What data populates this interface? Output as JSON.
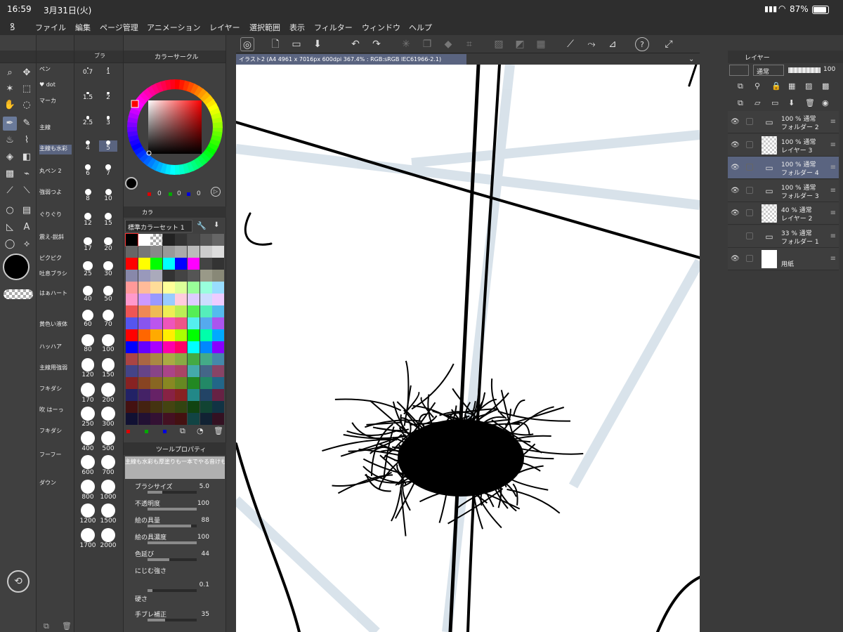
{
  "status": {
    "time": "16:59",
    "date": "3月31日(火)",
    "battery": "87%"
  },
  "menu": [
    "ファイル",
    "編集",
    "ページ管理",
    "アニメーション",
    "レイヤー",
    "選択範囲",
    "表示",
    "フィルター",
    "ウィンドウ",
    "ヘルプ"
  ],
  "doc_tab": "イラスト2 (A4 4961 x 7016px 600dpi 367.4% : RGB:sRGB IEC61966-2.1)",
  "panels": {
    "color_circle": "カラーサークル",
    "color_set_tab": "カラ",
    "color_set_name": "標準カラーセット 1",
    "tool_property": "ツールプロパティ",
    "layer": "レイヤー",
    "brush_tab": "ブラ"
  },
  "color_values": [
    "0",
    "0",
    "0"
  ],
  "subtools": [
    {
      "label": "ペン"
    },
    {
      "label": "♥ dot"
    },
    {
      "label": "マーカ"
    },
    {
      "label": "主線"
    },
    {
      "label": "主線も水彩"
    },
    {
      "label": "丸ペン 2"
    },
    {
      "label": "強弱つよ"
    },
    {
      "label": "ぐりぐり"
    },
    {
      "label": "震え-鋭斜"
    },
    {
      "label": "ピクピク"
    },
    {
      "label": "吐息ブラシ"
    },
    {
      "label": "はぁハート"
    },
    {
      "label": "黄色い液体"
    },
    {
      "label": "ハッハア"
    },
    {
      "label": "主線用強弱"
    },
    {
      "label": "フキダシ"
    },
    {
      "label": "吹 はーっ"
    },
    {
      "label": "フキダシ"
    },
    {
      "label": "フーフー"
    },
    {
      "label": "ダウン"
    }
  ],
  "brush_sizes": [
    "0.7",
    "1",
    "1.5",
    "2",
    "2.5",
    "3",
    "4",
    "5",
    "6",
    "7",
    "8",
    "10",
    "12",
    "15",
    "17",
    "20",
    "25",
    "30",
    "40",
    "50",
    "60",
    "70",
    "80",
    "100",
    "120",
    "150",
    "170",
    "200",
    "250",
    "300",
    "400",
    "500",
    "600",
    "700",
    "800",
    "1000",
    "1200",
    "1500",
    "1700",
    "2000"
  ],
  "brush_selected": "5",
  "tool_props": {
    "subtool_name": "主線も水彩も厚塗りも一本でやる音けものブラシ",
    "rows": [
      {
        "label": "ブラシサイズ",
        "value": "5.0",
        "level": 0.3
      },
      {
        "label": "不透明度",
        "value": "100",
        "level": 1.0
      },
      {
        "label": "絵の具量",
        "value": "88",
        "level": 0.88
      },
      {
        "label": "絵の具濃度",
        "value": "100",
        "level": 1.0
      },
      {
        "label": "色延び",
        "value": "44",
        "level": 0.44
      },
      {
        "label": "にじむ強さ",
        "value": "",
        "level": 0
      },
      {
        "label": "",
        "value": "0.1",
        "level": 0.1
      },
      {
        "label": "硬さ",
        "value": "",
        "level": 0
      },
      {
        "label": "手ブレ補正",
        "value": "35",
        "level": 0.35
      }
    ]
  },
  "layer_blend": "通常",
  "layer_opacity": "100",
  "layers": [
    {
      "line1": "100 % 通常",
      "line2": "フォルダー 2",
      "folder": true,
      "visible": true,
      "selected": false
    },
    {
      "line1": "100 % 通常",
      "line2": "レイヤー 3",
      "folder": false,
      "visible": true,
      "selected": false
    },
    {
      "line1": "100 % 通常",
      "line2": "フォルダー 4",
      "folder": true,
      "visible": true,
      "selected": true
    },
    {
      "line1": "100 % 通常",
      "line2": "フォルダー 3",
      "folder": true,
      "visible": true,
      "selected": false
    },
    {
      "line1": "40 % 通常",
      "line2": "レイヤー 2",
      "folder": false,
      "visible": true,
      "selected": false
    },
    {
      "line1": "33 % 通常",
      "line2": "フォルダー 1",
      "folder": true,
      "visible": false,
      "selected": false
    },
    {
      "line1": "",
      "line2": "用紙",
      "folder": false,
      "visible": true,
      "selected": false
    }
  ],
  "colors": {
    "accent": "#5a6480",
    "panel": "#404040",
    "canvas_bg": "#ffffff",
    "sketch": "#cfdce6"
  }
}
